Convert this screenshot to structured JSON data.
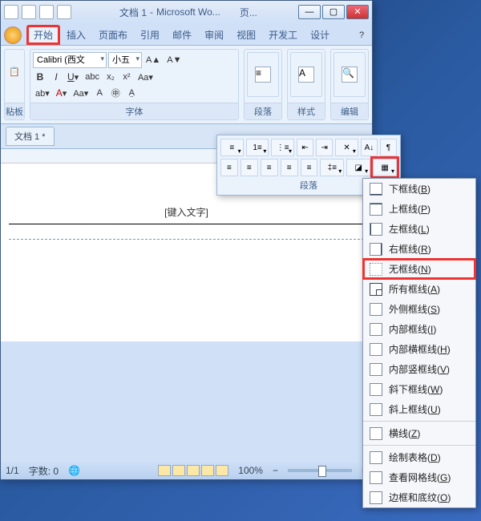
{
  "title": {
    "doc": "文档 1",
    "app": "Microsoft Wo...",
    "extra": "页..."
  },
  "tabs": {
    "home": "开始",
    "insert": "插入",
    "layout": "页面布",
    "ref": "引用",
    "mail": "邮件",
    "review": "审阅",
    "view": "视图",
    "dev": "开发工",
    "design": "设计"
  },
  "font": {
    "name_value": "Calibri (西文",
    "size_value": "小五",
    "group_label": "字体"
  },
  "clipboard": {
    "label": "粘板"
  },
  "paragraph": {
    "label": "段落"
  },
  "styles": {
    "label": "样式"
  },
  "editing": {
    "label": "编辑"
  },
  "doc_tab": "文档 1 *",
  "page": {
    "placeholder": "[键入文字]"
  },
  "status": {
    "page": "1/1",
    "words_label": "字数:",
    "words": "0",
    "zoom": "100%"
  },
  "border_menu": {
    "bottom": "下框线",
    "bottom_mn": "B",
    "top": "上框线",
    "top_mn": "P",
    "left": "左框线",
    "left_mn": "L",
    "right": "右框线",
    "right_mn": "R",
    "none": "无框线",
    "none_mn": "N",
    "all": "所有框线",
    "all_mn": "A",
    "outside": "外侧框线",
    "outside_mn": "S",
    "inside": "内部框线",
    "inside_mn": "I",
    "ins_h": "内部横框线",
    "ins_h_mn": "H",
    "ins_v": "内部竖框线",
    "ins_v_mn": "V",
    "diag_down": "斜下框线",
    "diag_down_mn": "W",
    "diag_up": "斜上框线",
    "diag_up_mn": "U",
    "hline": "横线",
    "hline_mn": "Z",
    "draw": "绘制表格",
    "draw_mn": "D",
    "grid": "查看网格线",
    "grid_mn": "G",
    "borders": "边框和底纹",
    "borders_mn": "O"
  },
  "colors": {
    "highlight": "#e33",
    "accent": "#3a5a8a"
  }
}
